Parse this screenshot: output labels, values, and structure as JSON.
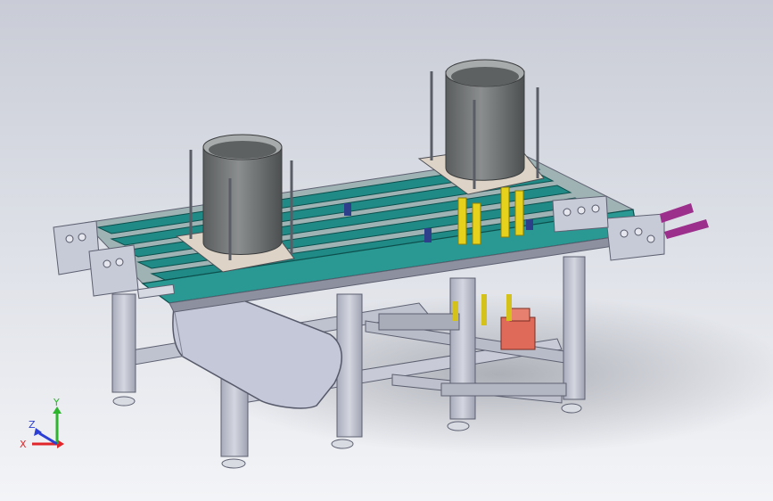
{
  "triad": {
    "x_label": "X",
    "y_label": "Y",
    "z_label": "Z",
    "x_color": "#e0262a",
    "y_color": "#2db52d",
    "z_color": "#2b3fd6"
  },
  "colors": {
    "belt": "#1f8a86",
    "frame": "#c3c6d3",
    "hopper": "#6b6e6f",
    "actuator": "#e6d21a",
    "cylinder_block": "#e06a5a",
    "end_rail": "#9c2f8c"
  },
  "scene": {
    "icon": "cad-assembly-icon",
    "description_visible_text": ""
  }
}
